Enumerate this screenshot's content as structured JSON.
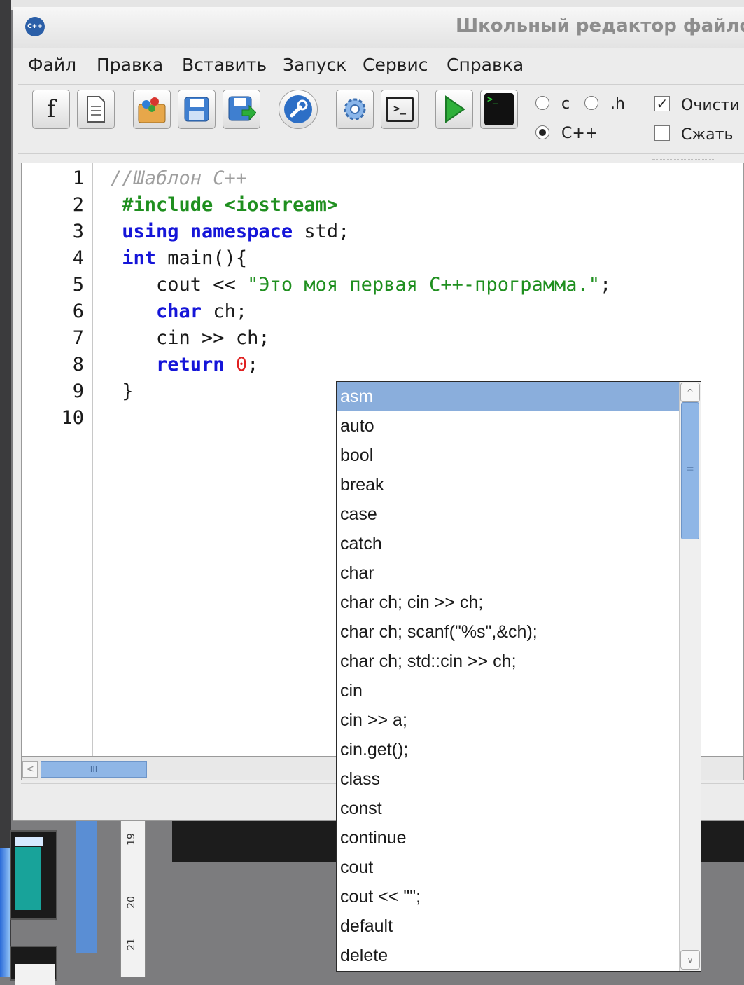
{
  "window": {
    "title": "Школьный редактор файлов",
    "app_icon_label": "C++"
  },
  "menu": [
    "Файл",
    "Правка",
    "Вставить",
    "Запуск",
    "Сервис",
    "Справка"
  ],
  "toolbar": {
    "buttons": [
      {
        "name": "function-button",
        "icon": "f-letter-icon",
        "label": "f"
      },
      {
        "name": "new-file-button",
        "icon": "document-icon"
      },
      {
        "name": "open-button",
        "icon": "open-folder-icon"
      },
      {
        "name": "save-button",
        "icon": "floppy-icon"
      },
      {
        "name": "save-as-button",
        "icon": "floppy-arrow-icon"
      },
      {
        "name": "settings-wrench-button",
        "icon": "wrench-icon"
      },
      {
        "name": "options-gear-button",
        "icon": "gear-icon"
      },
      {
        "name": "console-button",
        "icon": "terminal-icon",
        "label": ">_"
      },
      {
        "name": "run-button",
        "icon": "play-icon"
      },
      {
        "name": "run-terminal-button",
        "icon": "black-terminal-icon"
      }
    ],
    "lang_options": [
      {
        "label": "c",
        "selected": false
      },
      {
        "label": ".h",
        "selected": false
      },
      {
        "label": "C++",
        "selected": true
      }
    ],
    "checks": [
      {
        "label": "Очисти",
        "checked": true
      },
      {
        "label": "Сжать",
        "checked": false
      }
    ]
  },
  "editor": {
    "line_numbers": [
      "1",
      "2",
      "3",
      "4",
      "5",
      "6",
      "7",
      "8",
      "9",
      "10"
    ],
    "lines": {
      "l1": "//Шаблон C++",
      "l2": "#include <iostream>",
      "l3_kw": "using namespace",
      "l3_rest": " std;",
      "l4_kw": "int",
      "l4_rest": " main(){",
      "l5_a": "   cout << ",
      "l5_str": "\"Это моя первая C++-программа.\"",
      "l5_b": ";",
      "l6_kw": "char",
      "l6_rest": " ch;",
      "l7": "   cin >> ch;",
      "l8_kw": "return",
      "l8_num": "0",
      "l8_b": ";",
      "l9": " }",
      "l10": ""
    },
    "hscroll_grip": "III"
  },
  "completion": {
    "selected_index": 0,
    "items": [
      "asm",
      "auto",
      "bool",
      "break",
      "case",
      "catch",
      "char",
      "char ch; cin >> ch;",
      "char ch; scanf(\"%s\",&ch);",
      "char ch; std::cin >> ch;",
      "cin",
      "cin >> a;",
      "cin.get();",
      "class",
      "const",
      "continue",
      "cout",
      "cout << \"\";",
      "default",
      "delete"
    ]
  },
  "background": {
    "ruler_numbers": [
      "19",
      "20",
      "21"
    ]
  },
  "colors": {
    "keyword": "#1515d8",
    "preprocessor": "#1f8f1f",
    "string": "#1f8f1f",
    "number": "#e02020",
    "comment": "#9e9e9e",
    "selection": "#8aaedc"
  }
}
